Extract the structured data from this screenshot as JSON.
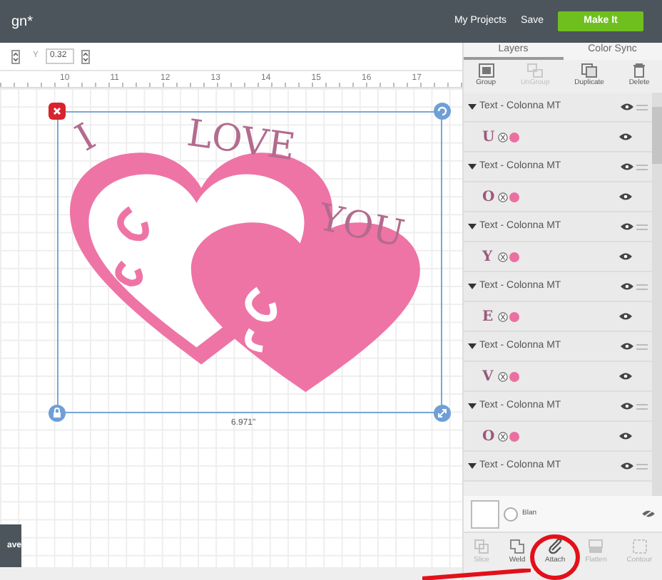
{
  "header": {
    "title": "gn*",
    "links": [
      "My Projects",
      "Save"
    ],
    "make_it": "Make It"
  },
  "toolbar": {
    "y_label": "Y",
    "y_value": "0.32"
  },
  "ruler": [
    "10",
    "11",
    "12",
    "13",
    "14",
    "15",
    "16",
    "17"
  ],
  "design": {
    "words": [
      "I",
      "LOVE",
      "YOU"
    ],
    "width_label": "6.971\""
  },
  "save_button": "ave",
  "panel": {
    "tabs": [
      {
        "label": "Layers",
        "selected": true
      },
      {
        "label": "Color Sync",
        "selected": false
      }
    ],
    "actions": [
      {
        "label": "Group",
        "disabled": false
      },
      {
        "label": "UnGroup",
        "disabled": true
      },
      {
        "label": "Duplicate",
        "disabled": false
      },
      {
        "label": "Delete",
        "disabled": false
      }
    ],
    "layers": [
      {
        "name": "Text - Colonna MT",
        "expanded": true,
        "children": [
          {
            "glyph": "U",
            "color": "#ec6fa2"
          }
        ]
      },
      {
        "name": "Text - Colonna MT",
        "expanded": true,
        "children": [
          {
            "glyph": "O",
            "color": "#ec6fa2"
          }
        ]
      },
      {
        "name": "Text - Colonna MT",
        "expanded": true,
        "children": [
          {
            "glyph": "Y",
            "color": "#ec6fa2"
          }
        ]
      },
      {
        "name": "Text - Colonna MT",
        "expanded": true,
        "children": [
          {
            "glyph": "E",
            "color": "#ec6fa2"
          }
        ]
      },
      {
        "name": "Text - Colonna MT",
        "expanded": true,
        "children": [
          {
            "glyph": "V",
            "color": "#ec6fa2"
          }
        ]
      },
      {
        "name": "Text - Colonna MT",
        "expanded": true,
        "children": [
          {
            "glyph": "O",
            "color": "#ec6fa2"
          }
        ]
      },
      {
        "name": "Text - Colonna MT",
        "expanded": true
      }
    ],
    "canvas_row": {
      "label": "Blan"
    },
    "bottom_actions": [
      {
        "label": "Slice",
        "disabled": true
      },
      {
        "label": "Weld",
        "disabled": false
      },
      {
        "label": "Attach",
        "disabled": false
      },
      {
        "label": "Flatten",
        "disabled": true
      },
      {
        "label": "Contour",
        "disabled": true
      }
    ]
  }
}
